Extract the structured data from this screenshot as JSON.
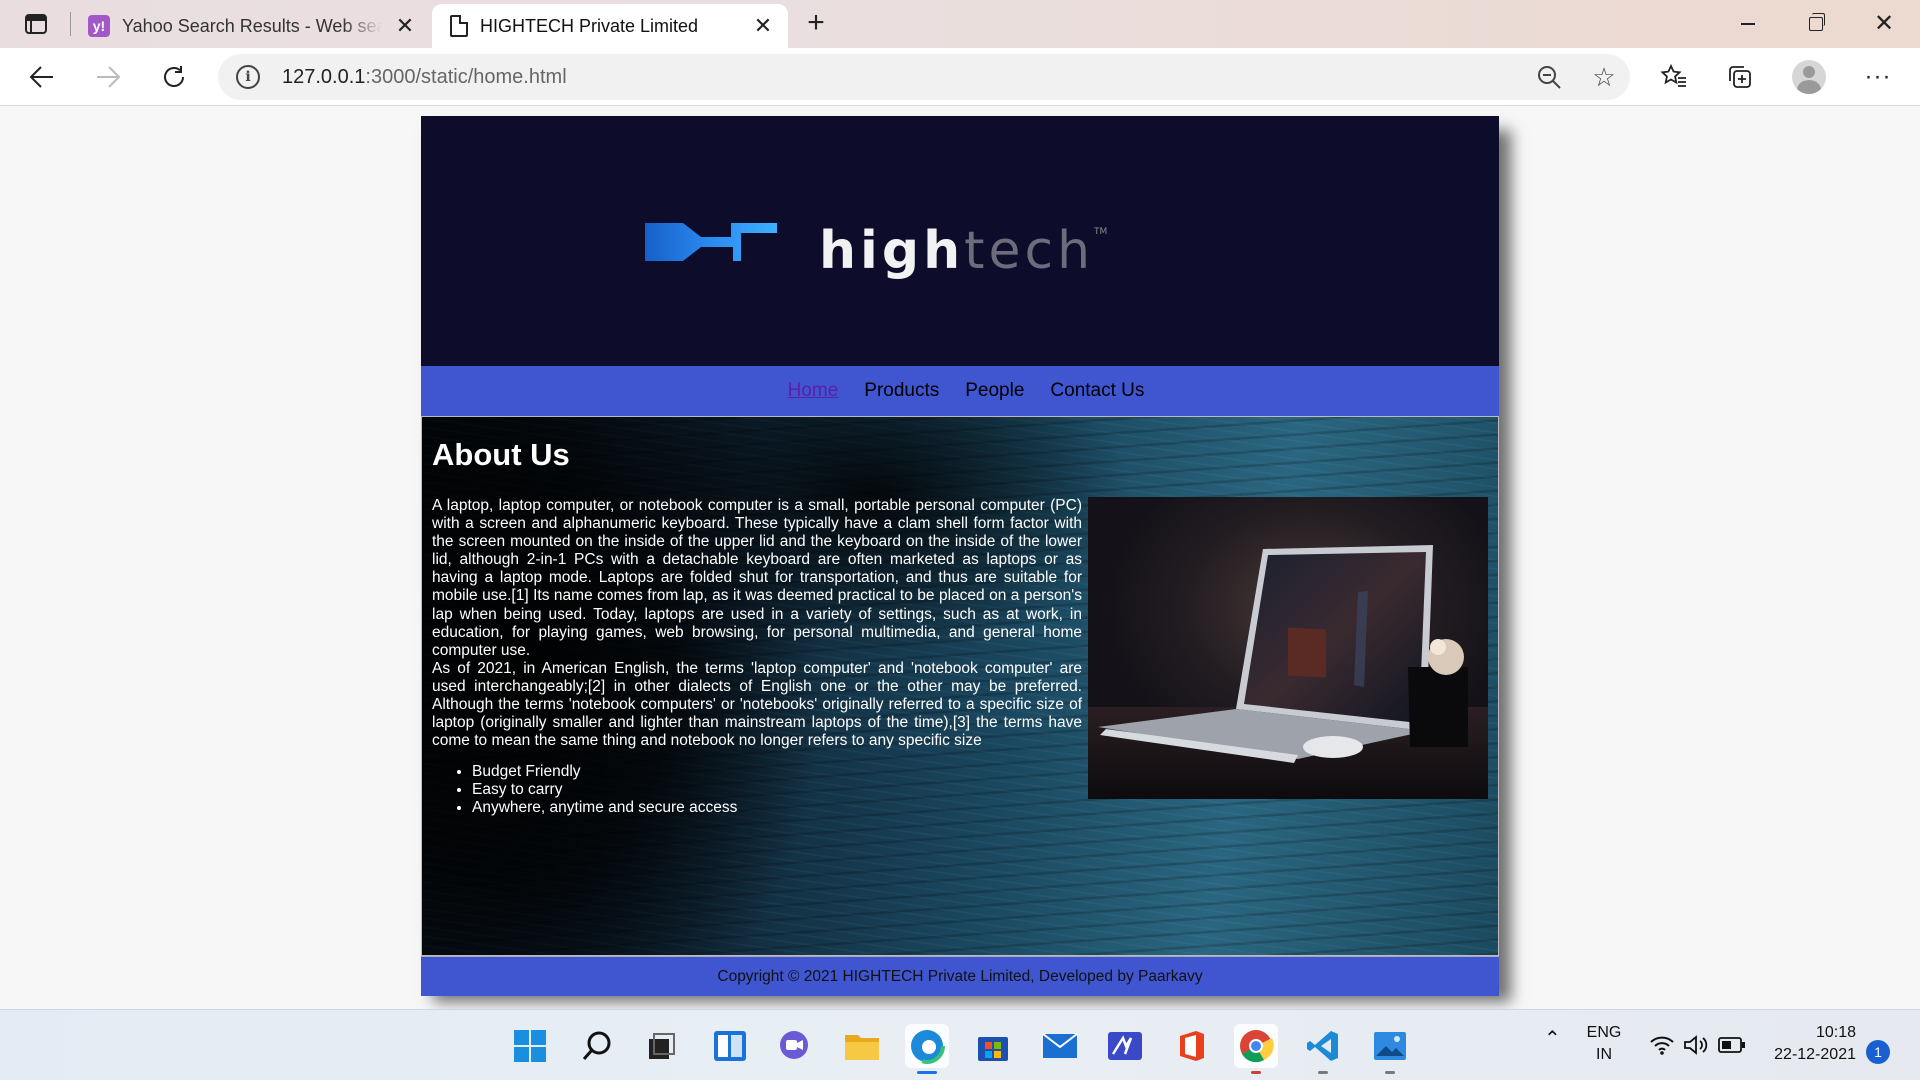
{
  "browser": {
    "tabs": [
      {
        "title": "Yahoo Search Results - Web search",
        "favicon": "yahoo-icon",
        "active": false
      },
      {
        "title": "HIGHTECH Private Limited",
        "favicon": "page-icon",
        "active": true
      }
    ],
    "address": {
      "host": "127.0.0.1",
      "rest": ":3000/static/home.html"
    }
  },
  "site": {
    "logo": {
      "strong": "high",
      "light": "tech",
      "tm": "TM"
    },
    "nav": [
      {
        "label": "Home",
        "active": true
      },
      {
        "label": "Products",
        "active": false
      },
      {
        "label": "People",
        "active": false
      },
      {
        "label": "Contact Us",
        "active": false
      }
    ],
    "about": {
      "title": "About Us",
      "paragraph1": "A laptop, laptop computer, or notebook computer is a small, portable personal computer (PC) with a screen and alphanumeric keyboard. These typically have a clam shell form factor with the screen mounted on the inside of the upper lid and the keyboard on the inside of the lower lid, although 2-in-1 PCs with a detachable keyboard are often marketed as laptops or as having a laptop mode. Laptops are folded shut for transportation, and thus are suitable for mobile use.[1] Its name comes from lap, as it was deemed practical to be placed on a person's lap when being used. Today, laptops are used in a variety of settings, such as at work, in education, for playing games, web browsing, for personal multimedia, and general home computer use.",
      "paragraph2": "As of 2021, in American English, the terms 'laptop computer' and 'notebook computer' are used interchangeably;[2] in other dialects of English one or the other may be preferred. Although the terms 'notebook computers' or 'notebooks' originally referred to a specific size of laptop (originally smaller and lighter than mainstream laptops of the time),[3] the terms have come to mean the same thing and notebook no longer refers to any specific size",
      "bullets": [
        "Budget Friendly",
        "Easy to carry",
        "Anywhere, anytime and secure access"
      ]
    },
    "footer": "Copyright © 2021 HIGHTECH Private Limited, Developed by Paarkavy"
  },
  "taskbar": {
    "apps": [
      "start-icon",
      "search-icon",
      "task-view-icon",
      "widgets-icon",
      "teams-chat-icon",
      "file-explorer-icon",
      "edge-icon",
      "store-icon",
      "mail-icon",
      "app-icon",
      "office-icon",
      "chrome-icon",
      "vscode-icon",
      "photos-icon"
    ],
    "language": {
      "line1": "ENG",
      "line2": "IN"
    },
    "clock": {
      "time": "10:18",
      "date": "22-12-2021"
    },
    "notifications": "1"
  },
  "colors": {
    "nav_blue": "#3f56d0",
    "header_navy": "#0d0d2b",
    "logo_blue": "#1e7de0"
  }
}
